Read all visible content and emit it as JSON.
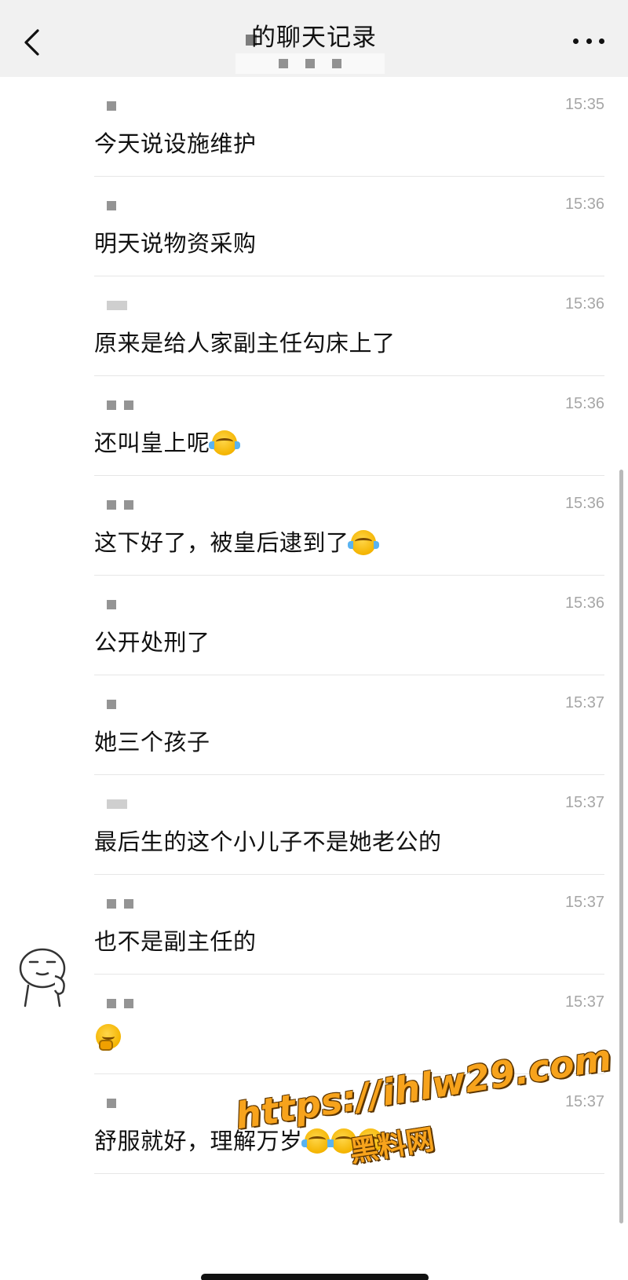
{
  "header": {
    "title": "的聊天记录",
    "back_icon": "chevron-left-icon",
    "more_icon": "more-dots-icon"
  },
  "messages": [
    {
      "time": "15:35",
      "text": "今天说设施维护",
      "emojis": []
    },
    {
      "time": "15:36",
      "text": "明天说物资采购",
      "emojis": []
    },
    {
      "time": "15:36",
      "text": "原来是给人家副主任勾床上了",
      "emojis": []
    },
    {
      "time": "15:36",
      "text": "还叫皇上呢",
      "emojis": [
        "cry"
      ]
    },
    {
      "time": "15:36",
      "text": "这下好了，被皇后逮到了",
      "emojis": [
        "cry"
      ]
    },
    {
      "time": "15:36",
      "text": "公开处刑了",
      "emojis": []
    },
    {
      "time": "15:37",
      "text": "她三个孩子",
      "emojis": []
    },
    {
      "time": "15:37",
      "text": "最后生的这个小儿子不是她老公的",
      "emojis": []
    },
    {
      "time": "15:37",
      "text": "也不是副主任的",
      "emojis": []
    },
    {
      "time": "15:37",
      "text": "",
      "emojis": [
        "think"
      ]
    },
    {
      "time": "15:37",
      "text": "舒服就好，理解万岁",
      "emojis": [
        "cry",
        "cry",
        "cry"
      ]
    }
  ],
  "watermark": {
    "url": "https://ihlw29.com",
    "name": "黑料网"
  },
  "colors": {
    "header_bg": "#f1f1f1",
    "time": "#a6a6a6",
    "watermark": "#f7a31c"
  }
}
